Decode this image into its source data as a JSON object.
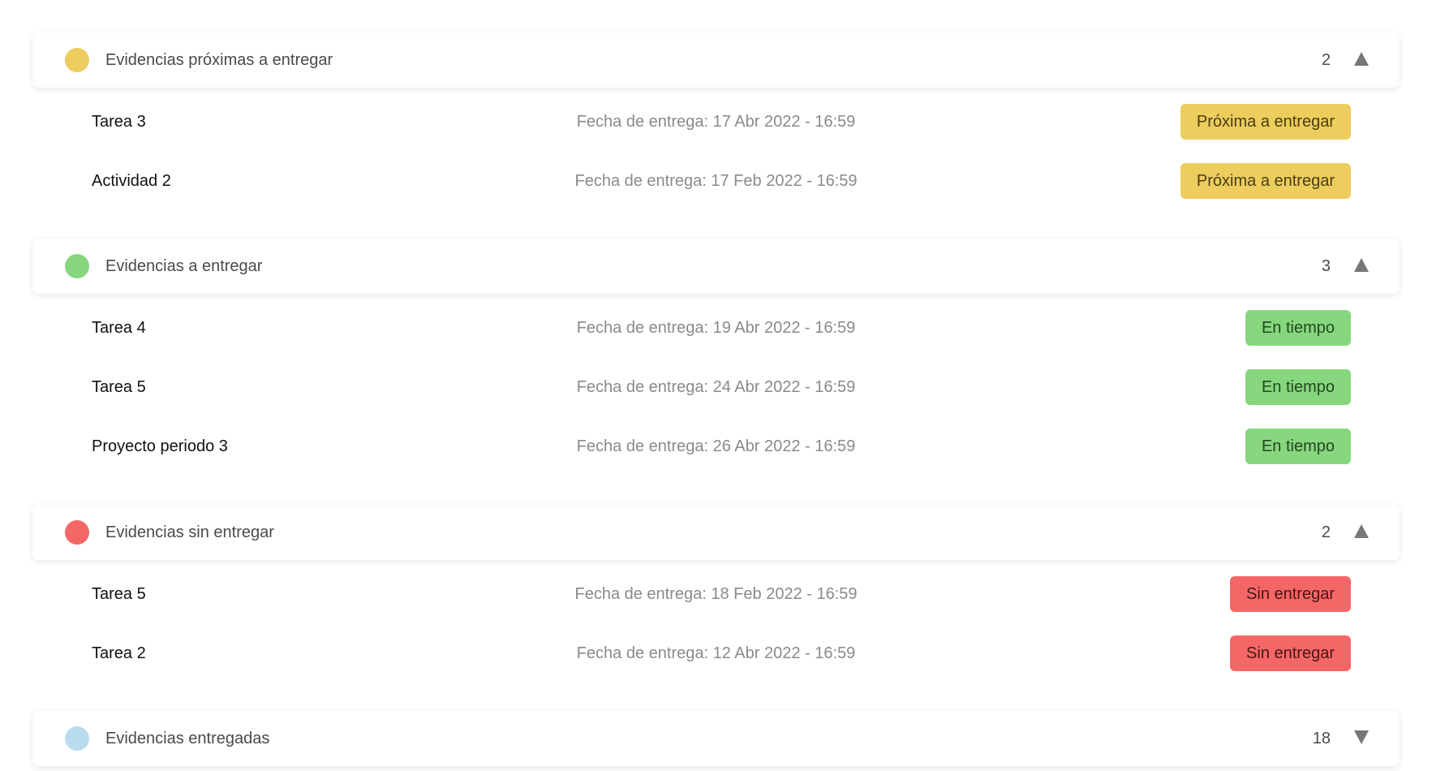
{
  "groups": [
    {
      "title": "Evidencias próximas a entregar",
      "count": "2",
      "dot_color": "#edcd5e",
      "expanded": true,
      "items": [
        {
          "name": "Tarea 3",
          "due": "Fecha de entrega: 17 Abr 2022 - 16:59",
          "status": "Próxima a entregar"
        },
        {
          "name": "Actividad 2",
          "due": "Fecha de entrega: 17 Feb 2022 - 16:59",
          "status": "Próxima a entregar"
        }
      ]
    },
    {
      "title": "Evidencias a entregar",
      "count": "3",
      "dot_color": "#86d77e",
      "expanded": true,
      "items": [
        {
          "name": "Tarea 4",
          "due": "Fecha de entrega: 19 Abr 2022 - 16:59",
          "status": "En tiempo"
        },
        {
          "name": "Tarea 5",
          "due": "Fecha de entrega: 24 Abr 2022 - 16:59",
          "status": "En tiempo"
        },
        {
          "name": "Proyecto periodo 3",
          "due": "Fecha de entrega: 26 Abr 2022 - 16:59",
          "status": "En tiempo"
        }
      ]
    },
    {
      "title": "Evidencias sin entregar",
      "count": "2",
      "dot_color": "#f56767",
      "expanded": true,
      "items": [
        {
          "name": "Tarea 5",
          "due": "Fecha de entrega: 18 Feb 2022 - 16:59",
          "status": "Sin entregar"
        },
        {
          "name": "Tarea 2",
          "due": "Fecha de entrega: 12 Abr 2022 - 16:59",
          "status": "Sin entregar"
        }
      ]
    },
    {
      "title": "Evidencias entregadas",
      "count": "18",
      "dot_color": "#b9dcef",
      "expanded": false,
      "items": []
    }
  ],
  "icons": {
    "expanded": "chevron-up-icon",
    "collapsed": "chevron-down-icon"
  }
}
